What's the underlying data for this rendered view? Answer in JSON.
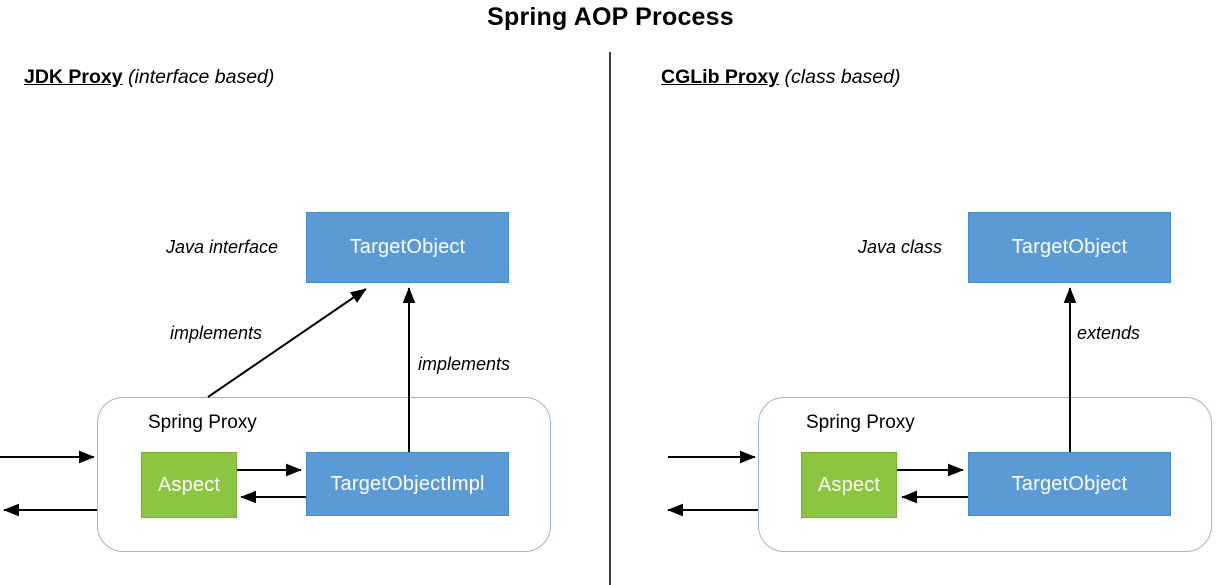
{
  "title": "Spring AOP Process",
  "colors": {
    "blue": "#5b9bd5",
    "green": "#8cc540",
    "divider": "#3c3c3c",
    "proxy_border": "#9cb6d4",
    "arrow": "#000000",
    "box_text": "#ffffff"
  },
  "panels": [
    {
      "id": "jdk",
      "heading_strong": "JDK Proxy",
      "heading_soft": "(interface based)",
      "top_label": "Java interface",
      "top_box": "TargetObject",
      "proxy_label": "Spring Proxy",
      "aspect_box": "Aspect",
      "impl_box": "TargetObjectImpl",
      "relations": [
        "implements",
        "implements"
      ]
    },
    {
      "id": "cglib",
      "heading_strong": "CGLib Proxy",
      "heading_soft": "(class based)",
      "top_label": "Java class",
      "top_box": "TargetObject",
      "proxy_label": "Spring Proxy",
      "aspect_box": "Aspect",
      "impl_box": "TargetObject",
      "relations": [
        "extends"
      ]
    }
  ]
}
